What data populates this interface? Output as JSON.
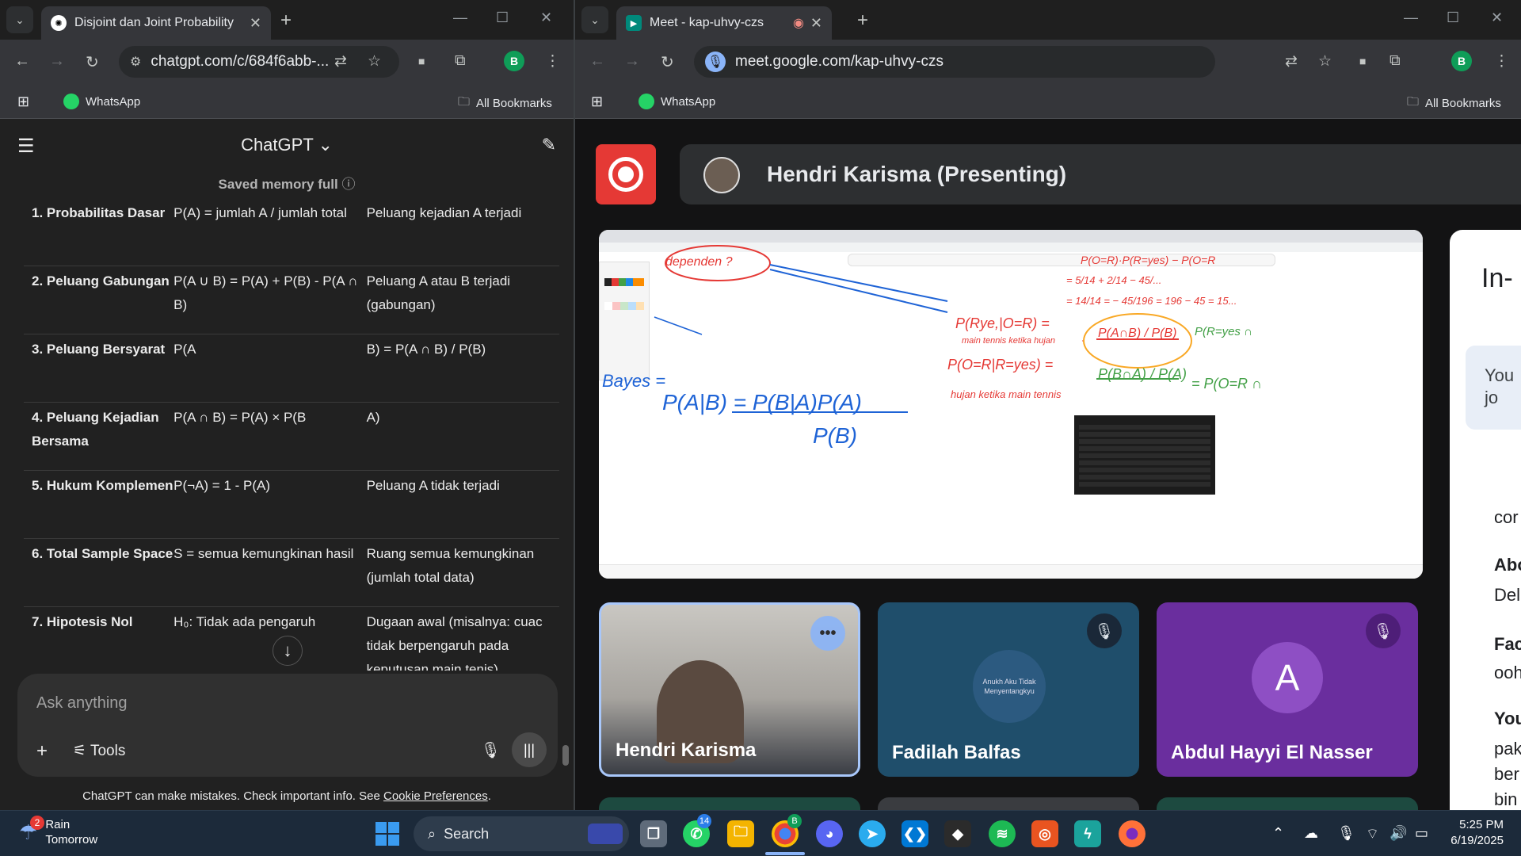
{
  "left_window": {
    "tab_title": "Disjoint dan Joint Probability",
    "url": "chatgpt.com/c/684f6abb-...",
    "profile_letter": "B",
    "bookmarks": {
      "whatsapp": "WhatsApp",
      "all": "All Bookmarks"
    }
  },
  "right_window": {
    "tab_title": "Meet - kap-uhvy-czs",
    "url": "meet.google.com/kap-uhvy-czs",
    "profile_letter": "B",
    "bookmarks": {
      "whatsapp": "WhatsApp",
      "all": "All Bookmarks"
    }
  },
  "chatgpt": {
    "title": "ChatGPT",
    "memory_note": "Saved memory full",
    "rows": [
      {
        "c1": "1. Probabilitas Dasar",
        "c2": "P(A) = jumlah A / jumlah total",
        "c3": "Peluang kejadian A terjadi"
      },
      {
        "c1": "2. Peluang Gabungan",
        "c2": "P(A ∪ B) = P(A) + P(B) - P(A ∩ B)",
        "c3": "Peluang A atau B terjadi (gabungan)"
      },
      {
        "c1": "3. Peluang Bersyarat",
        "c2": "P(A",
        "c3": "B) = P(A ∩ B) / P(B)"
      },
      {
        "c1": "4. Peluang Kejadian Bersama",
        "c2": "P(A ∩ B) = P(A) × P(B",
        "c3": "A)"
      },
      {
        "c1": "5. Hukum Komplemen",
        "c2": "P(¬A) = 1 - P(A)",
        "c3": "Peluang A tidak terjadi"
      },
      {
        "c1": "6. Total Sample Space",
        "c2": "S = semua kemungkinan hasil",
        "c3": "Ruang semua kemungkinan (jumlah total data)"
      },
      {
        "c1": "7. Hipotesis Nol",
        "c2": "H₀: Tidak ada pengaruh",
        "c3": "Dugaan awal (misalnya: cuac tidak berpengaruh pada keputusan main tenis)"
      }
    ],
    "input_placeholder": "Ask anything",
    "tools_label": "Tools",
    "disclaimer": "ChatGPT can make mistakes. Check important info. See ",
    "disclaimer_link": "Cookie Preferences",
    "disclaimer_end": "."
  },
  "meet": {
    "presenter_label": "Hendri Karisma (Presenting)",
    "whiteboard_lines": [
      "dependen ?",
      "P(O=R)·P(R=yes) − P(O=R",
      "= 5/14 + 2/14 − 45/...",
      "= 14/14 = − 45/196 = 196 − 45 = 15...",
      "P(Rye,|O=R) =",
      "main tennis ketika hujan",
      "P(A∩B) / P(B)",
      "P(R=yes ∩",
      "P(O=R|R=yes) =",
      "P(B∩A) / P(A)",
      "= P(O=R ∩",
      "hujan ketika main tennis",
      "Bayes =",
      "P(A|B) = P(B|A)P(A)",
      "P(B)"
    ],
    "side_panel": {
      "heading": "In-",
      "bubble": "You jo",
      "lines": [
        "cor",
        "Abo",
        "Del",
        "Fac",
        "ooh",
        "You",
        "pak",
        "ber",
        "bin"
      ]
    },
    "participants": [
      {
        "name": "Hendri Karisma"
      },
      {
        "name": "Fadilah Balfas",
        "avatar_text": "Anukh Aku Tidak Menyentangkyu"
      },
      {
        "name": "Abdul Hayyi El Nasser",
        "initial": "A"
      }
    ]
  },
  "taskbar": {
    "weather_title": "Rain",
    "weather_sub": "Tomorrow",
    "weather_badge": "2",
    "search_label": "Search",
    "whatsapp_badge": "14",
    "chrome_badge": "B",
    "time": "5:25 PM",
    "date": "6/19/2025"
  }
}
